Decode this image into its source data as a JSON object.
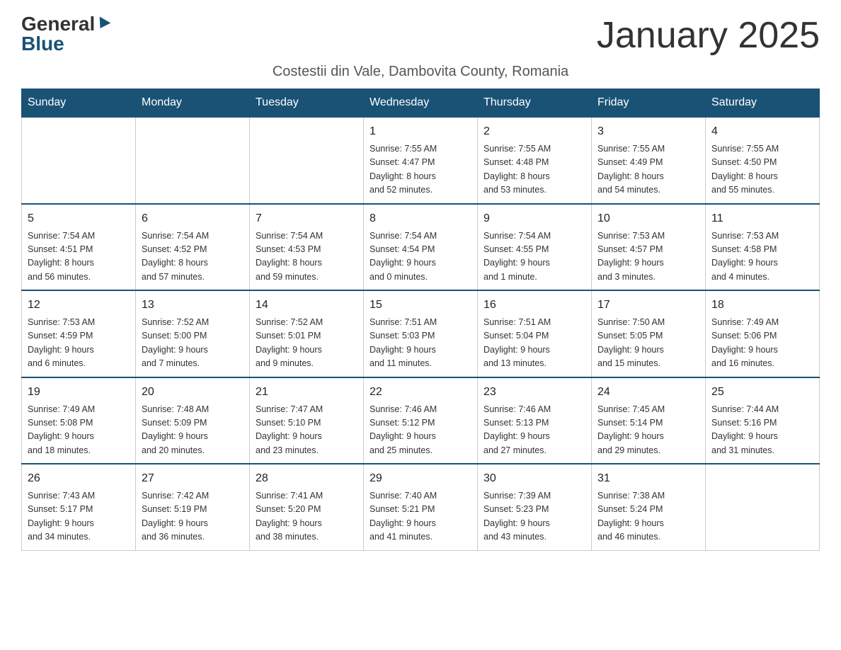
{
  "logo": {
    "general": "General",
    "blue": "Blue"
  },
  "title": "January 2025",
  "subtitle": "Costestii din Vale, Dambovita County, Romania",
  "days_of_week": [
    "Sunday",
    "Monday",
    "Tuesday",
    "Wednesday",
    "Thursday",
    "Friday",
    "Saturday"
  ],
  "weeks": [
    [
      {
        "day": "",
        "info": ""
      },
      {
        "day": "",
        "info": ""
      },
      {
        "day": "",
        "info": ""
      },
      {
        "day": "1",
        "info": "Sunrise: 7:55 AM\nSunset: 4:47 PM\nDaylight: 8 hours\nand 52 minutes."
      },
      {
        "day": "2",
        "info": "Sunrise: 7:55 AM\nSunset: 4:48 PM\nDaylight: 8 hours\nand 53 minutes."
      },
      {
        "day": "3",
        "info": "Sunrise: 7:55 AM\nSunset: 4:49 PM\nDaylight: 8 hours\nand 54 minutes."
      },
      {
        "day": "4",
        "info": "Sunrise: 7:55 AM\nSunset: 4:50 PM\nDaylight: 8 hours\nand 55 minutes."
      }
    ],
    [
      {
        "day": "5",
        "info": "Sunrise: 7:54 AM\nSunset: 4:51 PM\nDaylight: 8 hours\nand 56 minutes."
      },
      {
        "day": "6",
        "info": "Sunrise: 7:54 AM\nSunset: 4:52 PM\nDaylight: 8 hours\nand 57 minutes."
      },
      {
        "day": "7",
        "info": "Sunrise: 7:54 AM\nSunset: 4:53 PM\nDaylight: 8 hours\nand 59 minutes."
      },
      {
        "day": "8",
        "info": "Sunrise: 7:54 AM\nSunset: 4:54 PM\nDaylight: 9 hours\nand 0 minutes."
      },
      {
        "day": "9",
        "info": "Sunrise: 7:54 AM\nSunset: 4:55 PM\nDaylight: 9 hours\nand 1 minute."
      },
      {
        "day": "10",
        "info": "Sunrise: 7:53 AM\nSunset: 4:57 PM\nDaylight: 9 hours\nand 3 minutes."
      },
      {
        "day": "11",
        "info": "Sunrise: 7:53 AM\nSunset: 4:58 PM\nDaylight: 9 hours\nand 4 minutes."
      }
    ],
    [
      {
        "day": "12",
        "info": "Sunrise: 7:53 AM\nSunset: 4:59 PM\nDaylight: 9 hours\nand 6 minutes."
      },
      {
        "day": "13",
        "info": "Sunrise: 7:52 AM\nSunset: 5:00 PM\nDaylight: 9 hours\nand 7 minutes."
      },
      {
        "day": "14",
        "info": "Sunrise: 7:52 AM\nSunset: 5:01 PM\nDaylight: 9 hours\nand 9 minutes."
      },
      {
        "day": "15",
        "info": "Sunrise: 7:51 AM\nSunset: 5:03 PM\nDaylight: 9 hours\nand 11 minutes."
      },
      {
        "day": "16",
        "info": "Sunrise: 7:51 AM\nSunset: 5:04 PM\nDaylight: 9 hours\nand 13 minutes."
      },
      {
        "day": "17",
        "info": "Sunrise: 7:50 AM\nSunset: 5:05 PM\nDaylight: 9 hours\nand 15 minutes."
      },
      {
        "day": "18",
        "info": "Sunrise: 7:49 AM\nSunset: 5:06 PM\nDaylight: 9 hours\nand 16 minutes."
      }
    ],
    [
      {
        "day": "19",
        "info": "Sunrise: 7:49 AM\nSunset: 5:08 PM\nDaylight: 9 hours\nand 18 minutes."
      },
      {
        "day": "20",
        "info": "Sunrise: 7:48 AM\nSunset: 5:09 PM\nDaylight: 9 hours\nand 20 minutes."
      },
      {
        "day": "21",
        "info": "Sunrise: 7:47 AM\nSunset: 5:10 PM\nDaylight: 9 hours\nand 23 minutes."
      },
      {
        "day": "22",
        "info": "Sunrise: 7:46 AM\nSunset: 5:12 PM\nDaylight: 9 hours\nand 25 minutes."
      },
      {
        "day": "23",
        "info": "Sunrise: 7:46 AM\nSunset: 5:13 PM\nDaylight: 9 hours\nand 27 minutes."
      },
      {
        "day": "24",
        "info": "Sunrise: 7:45 AM\nSunset: 5:14 PM\nDaylight: 9 hours\nand 29 minutes."
      },
      {
        "day": "25",
        "info": "Sunrise: 7:44 AM\nSunset: 5:16 PM\nDaylight: 9 hours\nand 31 minutes."
      }
    ],
    [
      {
        "day": "26",
        "info": "Sunrise: 7:43 AM\nSunset: 5:17 PM\nDaylight: 9 hours\nand 34 minutes."
      },
      {
        "day": "27",
        "info": "Sunrise: 7:42 AM\nSunset: 5:19 PM\nDaylight: 9 hours\nand 36 minutes."
      },
      {
        "day": "28",
        "info": "Sunrise: 7:41 AM\nSunset: 5:20 PM\nDaylight: 9 hours\nand 38 minutes."
      },
      {
        "day": "29",
        "info": "Sunrise: 7:40 AM\nSunset: 5:21 PM\nDaylight: 9 hours\nand 41 minutes."
      },
      {
        "day": "30",
        "info": "Sunrise: 7:39 AM\nSunset: 5:23 PM\nDaylight: 9 hours\nand 43 minutes."
      },
      {
        "day": "31",
        "info": "Sunrise: 7:38 AM\nSunset: 5:24 PM\nDaylight: 9 hours\nand 46 minutes."
      },
      {
        "day": "",
        "info": ""
      }
    ]
  ]
}
